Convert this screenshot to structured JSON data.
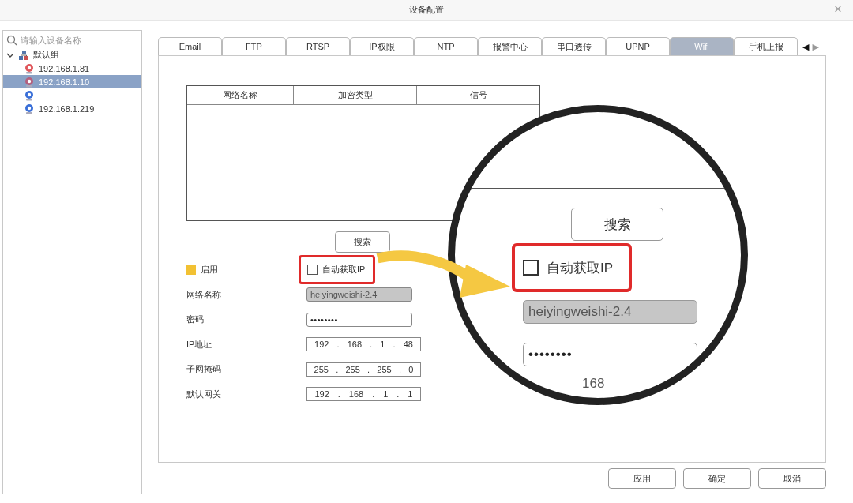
{
  "window": {
    "title": "设备配置",
    "close": "×"
  },
  "sidebar": {
    "search": {
      "placeholder": "请输入设备名称"
    },
    "tree": [
      {
        "label": "默认组",
        "kind": "group",
        "expanded": true,
        "selected": false,
        "children": [
          {
            "label": "192.168.1.81",
            "kind": "camera",
            "color": "#e0565b",
            "selected": false
          },
          {
            "label": "192.168.1.10",
            "kind": "camera",
            "color": "#b4607e",
            "selected": true
          },
          {
            "kind": "camera",
            "color": "#3a6fd8",
            "selected": false
          },
          {
            "label": "192.168.1.219",
            "kind": "camera",
            "color": "#3a6fd8",
            "selected": false
          }
        ]
      }
    ]
  },
  "tabs": [
    {
      "label": "Email",
      "selected": false
    },
    {
      "label": "FTP",
      "selected": false
    },
    {
      "label": "RTSP",
      "selected": false
    },
    {
      "label": "IP权限",
      "selected": false
    },
    {
      "label": "NTP",
      "selected": false
    },
    {
      "label": "报警中心",
      "selected": false
    },
    {
      "label": "串口透传",
      "selected": false
    },
    {
      "label": "UPNP",
      "selected": false
    },
    {
      "label": "Wifi",
      "selected": true
    },
    {
      "label": "手机上报",
      "selected": false
    }
  ],
  "tab_scroll": [
    {
      "label": "◀",
      "disabled": false
    },
    {
      "label": "▶",
      "disabled": true
    }
  ],
  "wifi_table": {
    "columns": [
      "网络名称",
      "加密类型",
      "信号"
    ]
  },
  "search_button": "搜索",
  "enable": {
    "label": "启用",
    "checked": true
  },
  "auto_ip": {
    "label": "自动获取IP",
    "checked": false,
    "highlighted": true
  },
  "fields": [
    {
      "label": "网络名称",
      "kind": "text",
      "value": "heiyingweishi-2.4",
      "disabled": true
    },
    {
      "label": "密码",
      "kind": "password",
      "value": "••••••••",
      "disabled": false
    },
    {
      "label": "IP地址",
      "kind": "ip",
      "octets": [
        "192",
        "168",
        "1",
        "48"
      ],
      "separator": "."
    },
    {
      "label": "子网掩码",
      "kind": "ip",
      "octets": [
        "255",
        "255",
        "255",
        "0"
      ],
      "separator": "."
    },
    {
      "label": "默认网关",
      "kind": "ip",
      "octets": [
        "192",
        "168",
        "1",
        "1"
      ],
      "separator": "."
    }
  ],
  "magnifier": {
    "search_button": "搜索",
    "auto_ip": {
      "label": "自动获取IP",
      "checked": false
    },
    "network_name": "heiyingweishi-2.4",
    "password": "••••••••",
    "ip_fragment": "168"
  },
  "footer_buttons": [
    "应用",
    "确定",
    "取消"
  ]
}
